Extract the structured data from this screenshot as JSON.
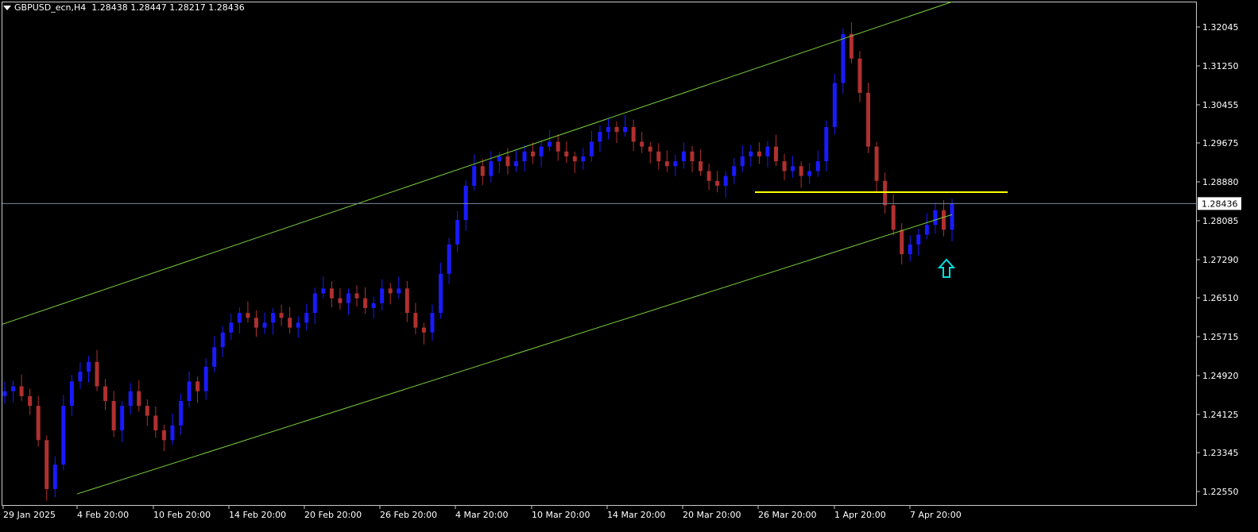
{
  "header": {
    "menu_icon": "triangle-down-icon",
    "symbol": "GBPUSD_ecn,H4",
    "ohlc": "1.28438 1.28447 1.28217 1.28436"
  },
  "colors": {
    "background": "#000000",
    "frame": "#c8c8c8",
    "bull_candle": "#1a1aff",
    "bear_candle": "#b03030",
    "channel_line": "#7ad03a",
    "resistance_line": "#ffff00",
    "bid_line": "#7a8a99",
    "arrow": "#00e0e0"
  },
  "chart_data": {
    "type": "candlestick",
    "symbol": "GBPUSD_ecn",
    "timeframe": "H4",
    "y_ticks": [
      "1.32045",
      "1.31250",
      "1.30455",
      "1.29675",
      "1.28880",
      "1.28085",
      "1.27290",
      "1.26510",
      "1.25715",
      "1.24920",
      "1.24125",
      "1.23345",
      "1.22550"
    ],
    "y_range": [
      1.2225,
      1.3258
    ],
    "x_ticks": [
      "29 Jan 2025",
      "4 Feb 20:00",
      "10 Feb 20:00",
      "14 Feb 20:00",
      "20 Feb 20:00",
      "26 Feb 20:00",
      "4 Mar 20:00",
      "10 Mar 20:00",
      "14 Mar 20:00",
      "20 Mar 20:00",
      "26 Mar 20:00",
      "1 Apr 20:00",
      "7 Apr 20:00"
    ],
    "current_price": "1.28436",
    "approx_closes": [
      1.246,
      1.247,
      1.245,
      1.243,
      1.236,
      1.226,
      1.231,
      1.243,
      1.248,
      1.25,
      1.252,
      1.247,
      1.244,
      1.238,
      1.243,
      1.246,
      1.243,
      1.241,
      1.238,
      1.236,
      1.239,
      1.244,
      1.248,
      1.246,
      1.251,
      1.255,
      1.258,
      1.26,
      1.262,
      1.261,
      1.259,
      1.26,
      1.262,
      1.261,
      1.259,
      1.26,
      1.262,
      1.266,
      1.267,
      1.265,
      1.264,
      1.266,
      1.265,
      1.263,
      1.264,
      1.267,
      1.266,
      1.267,
      1.262,
      1.259,
      1.258,
      1.262,
      1.27,
      1.276,
      1.281,
      1.288,
      1.292,
      1.29,
      1.293,
      1.294,
      1.292,
      1.293,
      1.295,
      1.294,
      1.296,
      1.297,
      1.295,
      1.294,
      1.293,
      1.294,
      1.297,
      1.299,
      1.3,
      1.299,
      1.3,
      1.297,
      1.296,
      1.295,
      1.293,
      1.292,
      1.293,
      1.295,
      1.293,
      1.291,
      1.289,
      1.288,
      1.29,
      1.292,
      1.294,
      1.295,
      1.294,
      1.296,
      1.293,
      1.291,
      1.292,
      1.29,
      1.291,
      1.293,
      1.3,
      1.309,
      1.319,
      1.314,
      1.307,
      1.296,
      1.289,
      1.284,
      1.279,
      1.274,
      1.276,
      1.278,
      1.28,
      1.283,
      1.279,
      1.2844
    ],
    "channel_upper": {
      "from": [
        "29 Jan 2025",
        1.2597
      ],
      "to": [
        "7 Apr 20:00",
        1.3256
      ]
    },
    "channel_lower": {
      "from": [
        "4 Feb 20:00",
        1.225
      ],
      "to": [
        "7 Apr 20:00",
        1.2821
      ]
    },
    "resistance_level": 1.2867,
    "signal": "up-arrow"
  }
}
